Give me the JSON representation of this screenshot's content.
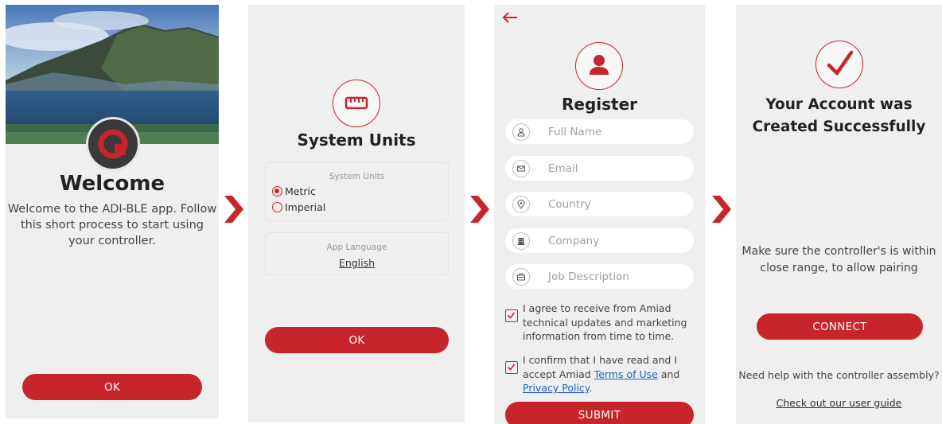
{
  "colors": {
    "accent": "#c8242b",
    "background": "#efefef",
    "link": "#1e5fc4"
  },
  "welcome": {
    "title": "Welcome",
    "text": "Welcome to the ADI-BLE app. Follow this short process to start using your controller.",
    "ok_label": "OK",
    "logo_icon": "amiad-logo-icon"
  },
  "units": {
    "title": "System Units",
    "icon": "ruler-icon",
    "units_card_label": "System Units",
    "options": [
      {
        "label": "Metric",
        "selected": true
      },
      {
        "label": "Imperial",
        "selected": false
      }
    ],
    "language_card_label": "App Language",
    "language_value": "English",
    "ok_label": "OK"
  },
  "register": {
    "title": "Register",
    "icon": "user-icon",
    "back_icon": "arrow-left-icon",
    "fields": [
      {
        "placeholder": "Full Name",
        "icon": "user-icon"
      },
      {
        "placeholder": "Email",
        "icon": "mail-icon"
      },
      {
        "placeholder": "Country",
        "icon": "location-pin-icon"
      },
      {
        "placeholder": "Company",
        "icon": "building-icon"
      },
      {
        "placeholder": "Job Description",
        "icon": "briefcase-icon"
      }
    ],
    "consent1": "I agree to receive from Amiad technical updates and marketing information from time to time.",
    "consent2_prefix": "I confirm that I have read and I accept Amiad ",
    "terms_link": "Terms of Use",
    "consent2_and": " and ",
    "privacy_link": "Privacy Policy",
    "consent2_suffix": ".",
    "submit_label": "SUBMIT"
  },
  "success": {
    "title_line1": "Your Account was",
    "title_line2": "Created Successfully",
    "icon": "checkmark-icon",
    "text": "Make sure the controller's is within close range, to allow pairing",
    "connect_label": "CONNECT",
    "help_text": "Need help with the controller assembly?",
    "guide_link": "Check out our user guide"
  }
}
